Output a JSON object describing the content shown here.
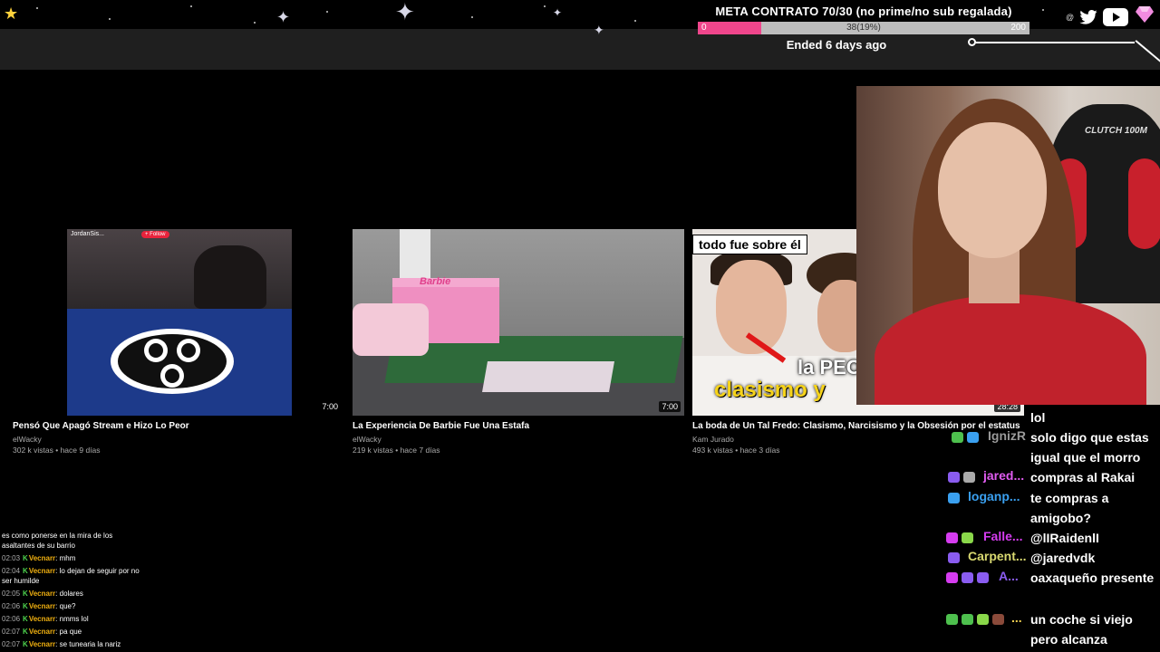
{
  "overlay": {
    "goal_title": "META CONTRATO 70/30 (no prime/no sub regalada)",
    "goal_min": "0",
    "goal_current": "38(19%)",
    "goal_max": "200",
    "goal_progress_pct": 19,
    "goal_status": "Ended 6 days ago",
    "social_at": "@",
    "accent_pink": "#f0468c"
  },
  "videos": [
    {
      "title": "Pensó Que Apagó Stream e Hizo Lo Peor",
      "channel": "elWacky",
      "meta": "302 k vistas • hace 9 días",
      "duration": "7:00",
      "thumb_username": "JordanSis...",
      "thumb_follow": "+ Follow"
    },
    {
      "title": "La Experiencia De Barbie Fue Una Estafa",
      "channel": "elWacky",
      "meta": "219 k vistas • hace 7 días",
      "duration": "7:00",
      "thumb_text": "Barbie"
    },
    {
      "title": "La boda de Un Tal Fredo: Clasismo, Narcisismo y la Obsesión por el estatus",
      "channel": "Kam Jurado",
      "meta": "493 k vistas • hace 3 días",
      "duration": "28:28",
      "thumb_label": "todo fue sobre él",
      "thumb_peo": "la PEO",
      "thumb_clasismo": "clasismo y"
    }
  ],
  "webcam": {
    "chair_text": "CLUTCH 100M"
  },
  "right_chat": [
    {
      "name": "",
      "name_color": "#ffffff",
      "text": "lol"
    },
    {
      "name": "IgnizR",
      "name_color": "#9a9a9a",
      "text": "solo digo que estas igual que el morro compras al Rakai"
    },
    {
      "name": "jared...",
      "name_color": "#e05cf0",
      "text": ""
    },
    {
      "name": "loganp...",
      "name_color": "#3aa0f0",
      "text": "te compras a amigobo?"
    },
    {
      "name": "Falle...",
      "name_color": "#d63cf0",
      "text": "@lIRaidenlI"
    },
    {
      "name": "Carpent...",
      "name_color": "#d8d870",
      "text": "@jaredvdk"
    },
    {
      "name": "A...",
      "name_color": "#8a5cf0",
      "text": "oaxaqueño presente"
    },
    {
      "name": "...",
      "name_color": "#f0d050",
      "text": "un coche si viejo pero alcanza"
    }
  ],
  "left_chat": [
    {
      "time": "",
      "name": "",
      "text": "es como ponerse en la mira de los asaltantes de su barrio"
    },
    {
      "time": "02:03",
      "name": "Vecnarr",
      "text": "mhm"
    },
    {
      "time": "02:04",
      "name": "Vecnarr",
      "text": "lo dejan de seguir por no ser humilde"
    },
    {
      "time": "02:05",
      "name": "Vecnarr",
      "text": "dolares"
    },
    {
      "time": "02:06",
      "name": "Vecnarr",
      "text": "que?"
    },
    {
      "time": "02:06",
      "name": "Vecnarr",
      "text": "nmms lol"
    },
    {
      "time": "02:07",
      "name": "Vecnarr",
      "text": "pa que"
    },
    {
      "time": "02:07",
      "name": "Vecnarr",
      "text": "se tunearia la nariz"
    }
  ]
}
